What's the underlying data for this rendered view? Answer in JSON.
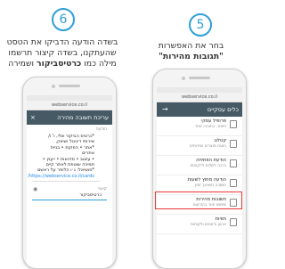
{
  "step1": {
    "number": "6",
    "instruction_lines": [
      "בשדה הודעה הדביקו את הטסט",
      "שהעתקנו, בשדה קיצור תרשמו"
    ],
    "instruction_line3_pre": "מילה כמו ",
    "instruction_line3_bold": "כרטיסביקור",
    "instruction_line3_post": " ושמירה",
    "phone": {
      "url": "webservice.co.il",
      "appbar_title": "עריכת תשובה מהירה",
      "close_icon": "×",
      "message_label": "הודעה",
      "message_lines": [
        "*כרטיס הביקור שלי, ו' ו/",
        "שירותי דיגיטל ושיווק,",
        "*אתר • הפקות • בניית אתרים",
        "• עיצוב • סדנאות • ייעוץ •",
        "תמיכה שוטפת לאתר קיים",
        "*סושיאל: ג׳ו הלופר על ראשם",
        "https://webservice.co.il/cards/"
      ],
      "shortcut_label": "קיצור",
      "shortcut_value": "כרטיסביקור"
    }
  },
  "step2": {
    "number": "5",
    "instruction_line1": "בחר את האפשרות",
    "instruction_line2": "\"תגובות מהירות\"",
    "phone": {
      "url": "webservice.co.il",
      "appbar_title": "כלים עסקיים",
      "items": [
        {
          "title": "פרופיל עסקי",
          "sub": "תיאור, כתובת, אתר"
        },
        {
          "title": "קטלוג",
          "sub": "הצגת מוצרים ושירותים"
        },
        {
          "title": "הודעת הפתיחה",
          "sub": "ברכה לשלוח ללקוחות"
        },
        {
          "title": "הודעה מחוץ לשעות",
          "sub": "תשובה כשאינך זמין"
        },
        {
          "title": "תשובות מהירות",
          "sub": "שימוש חוזר בהודעות"
        },
        {
          "title": "תוויות",
          "sub": "ארגון צ'אטים ולקוחות"
        }
      ]
    }
  }
}
